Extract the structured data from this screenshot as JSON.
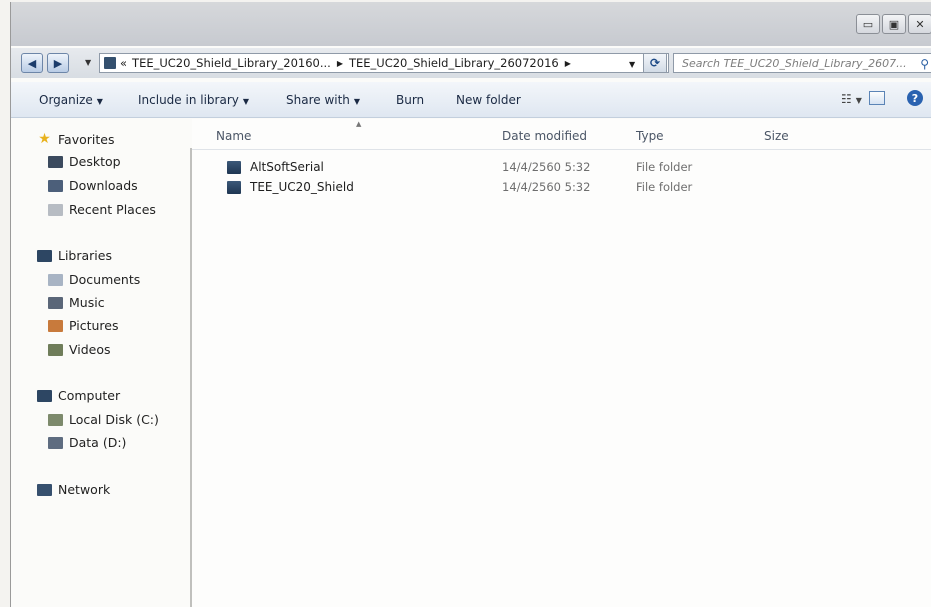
{
  "window": {
    "controls": {
      "minimize": "▭",
      "maximize": "▣",
      "close": "✕"
    }
  },
  "address": {
    "back_icon": "back-arrow-icon",
    "forward_icon": "forward-arrow-icon",
    "overflow": "«",
    "crumbs": [
      "TEE_UC20_Shield_Library_20160...",
      "TEE_UC20_Shield_Library_26072016"
    ],
    "search_placeholder": "Search TEE_UC20_Shield_Library_2607..."
  },
  "toolbar": {
    "organize": "Organize",
    "include_in_library": "Include in library",
    "share_with": "Share with",
    "burn": "Burn",
    "new_folder": "New folder"
  },
  "navigation": {
    "favorites": {
      "header": "Favorites",
      "items": [
        "Desktop",
        "Downloads",
        "Recent Places"
      ]
    },
    "libraries": {
      "header": "Libraries",
      "items": [
        "Documents",
        "Music",
        "Pictures",
        "Videos"
      ]
    },
    "computer": {
      "header": "Computer",
      "items": [
        "Local Disk (C:)",
        "Data (D:)"
      ]
    },
    "network": {
      "header": "Network"
    }
  },
  "columns": {
    "name": "Name",
    "date_modified": "Date modified",
    "type": "Type",
    "size": "Size"
  },
  "files": [
    {
      "name": "AltSoftSerial",
      "date_modified": "14/4/2560 5:32",
      "type": "File folder",
      "size": ""
    },
    {
      "name": "TEE_UC20_Shield",
      "date_modified": "14/4/2560 5:32",
      "type": "File folder",
      "size": ""
    }
  ],
  "colors": {
    "accent": "#2a62b0",
    "folder_icon": "#2f4b6b",
    "command_text": "#1b2a44"
  }
}
